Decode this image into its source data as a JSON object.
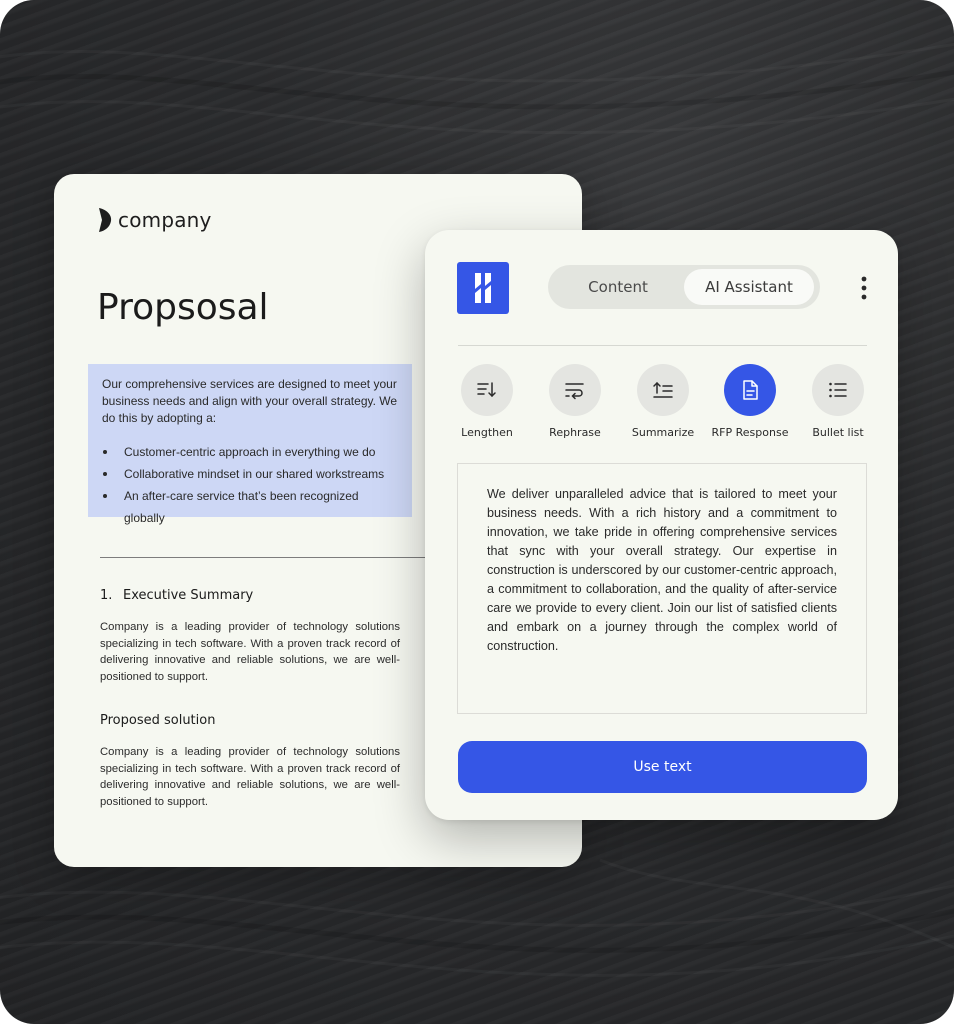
{
  "document": {
    "logo_text": "company",
    "title": "Propsosal",
    "intro": "Our comprehensive services are designed to meet your business needs and align with your overall strategy. We do this by adopting a:",
    "bullets": [
      "Customer-centric approach in everything we do",
      "Collaborative mindset in our shared workstreams",
      "An after-care service that’s been recognized globally"
    ],
    "section1": {
      "number": "1.",
      "heading": "Executive Summary",
      "body": "Company is a leading provider of technology solutions specializing in tech software. With a proven track record of delivering innovative and reliable solutions, we are well-positioned to support."
    },
    "section2": {
      "heading": "Proposed solution",
      "body": "Company is a leading provider of technology solutions specializing in tech software. With a proven track record of delivering innovative and reliable solutions, we are well-positioned to support."
    }
  },
  "assistant": {
    "tabs": [
      {
        "label": "Content",
        "active": false
      },
      {
        "label": "AI Assistant",
        "active": true
      }
    ],
    "tools": [
      {
        "label": "Lengthen",
        "icon": "lengthen-icon"
      },
      {
        "label": "Rephrase",
        "icon": "rephrase-icon"
      },
      {
        "label": "Summarize",
        "icon": "summarize-icon"
      },
      {
        "label": "RFP Response",
        "icon": "document-icon",
        "active": true
      },
      {
        "label": "Bullet list",
        "icon": "bullet-list-icon"
      }
    ],
    "generated_text": "We deliver unparalleled advice that is tailored to meet your business needs. With a rich history and a commitment to innovation, we take pride in offering comprehensive services that sync with your overall strategy. Our expertise in construction is underscored by our customer-centric approach, a commitment to collaboration, and the quality of after-service care we provide to every client. Join our list of satisfied clients and embark on a journey through the complex world of construction.",
    "use_button": "Use text"
  },
  "colors": {
    "accent": "#3556e6",
    "highlight": "#cdd7f5",
    "card": "#f6f8f1",
    "background": "#2b2c2e"
  }
}
